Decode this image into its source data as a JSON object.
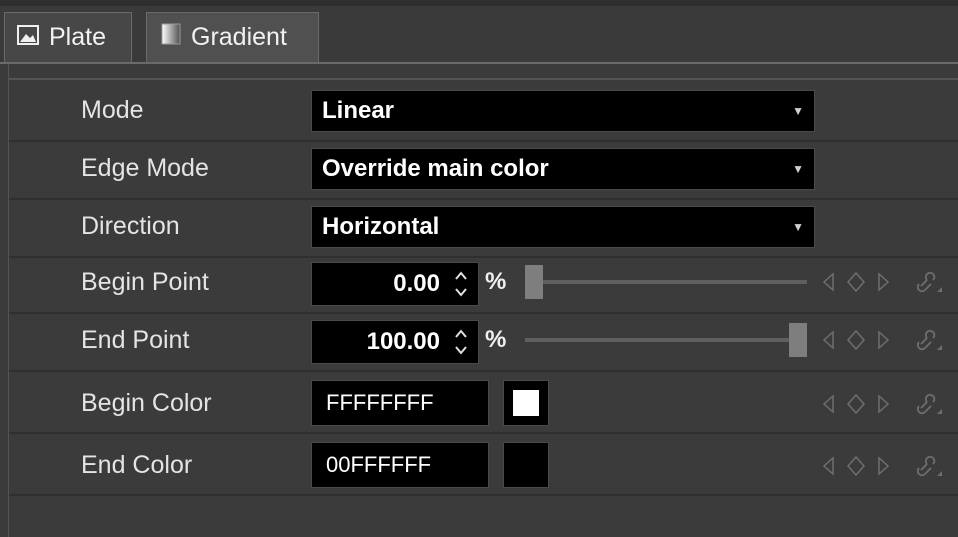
{
  "tabs": [
    {
      "label": "Plate",
      "icon": "image-icon",
      "active": false
    },
    {
      "label": "Gradient",
      "icon": "gradient-icon",
      "active": true
    }
  ],
  "fields": {
    "mode": {
      "label": "Mode",
      "value": "Linear"
    },
    "edge_mode": {
      "label": "Edge Mode",
      "value": "Override main color"
    },
    "direction": {
      "label": "Direction",
      "value": "Horizontal"
    },
    "begin_point": {
      "label": "Begin Point",
      "value": "0.00",
      "unit": "%",
      "slider_fraction": 0.0
    },
    "end_point": {
      "label": "End Point",
      "value": "100.00",
      "unit": "%",
      "slider_fraction": 1.0
    },
    "begin_color": {
      "label": "Begin Color",
      "hex": "FFFFFFFF",
      "swatch": "#ffffff"
    },
    "end_color": {
      "label": "End Color",
      "hex": "00FFFFFF",
      "swatch": "#000000"
    }
  },
  "colors": {
    "background": "#3b3b3b",
    "field_bg": "#000000",
    "text": "#e4e4e4",
    "muted_icon": "#6e6e6e"
  }
}
